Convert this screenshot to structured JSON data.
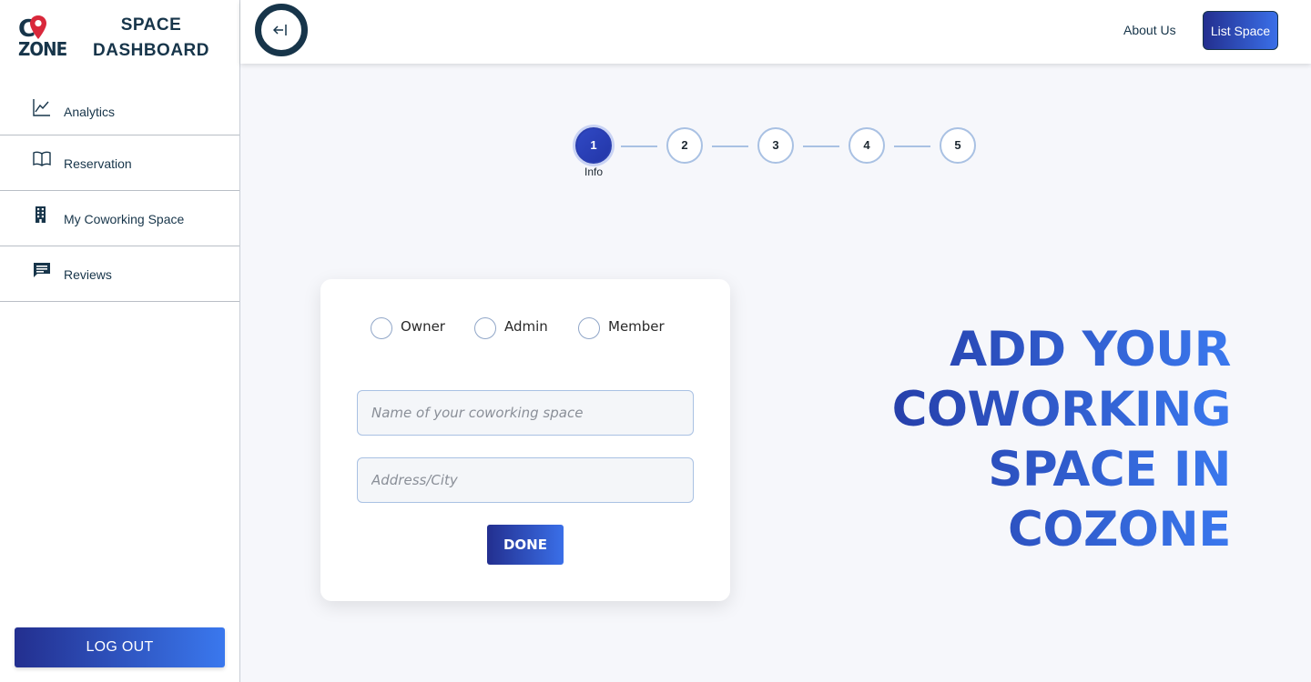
{
  "brand": {
    "logo_top": "C",
    "logo_bottom": "ZONE",
    "title_line1": "SPACE",
    "title_line2": "DASHBOARD"
  },
  "sidebar": {
    "items": [
      {
        "label": "Analytics",
        "icon": "chart-line-icon"
      },
      {
        "label": "Reservation",
        "icon": "book-open-icon"
      },
      {
        "label": "My Coworking Space",
        "icon": "building-icon"
      },
      {
        "label": "Reviews",
        "icon": "message-icon"
      }
    ],
    "logout_label": "LOG OUT"
  },
  "header": {
    "collapse_icon": "arrow-left-bar-icon",
    "about_label": "About Us",
    "list_space_label": "List Space"
  },
  "stepper": {
    "steps": [
      "1",
      "2",
      "3",
      "4",
      "5"
    ],
    "active_step": 1,
    "active_caption": "Info"
  },
  "form": {
    "roles": [
      "Owner",
      "Admin",
      "Member"
    ],
    "name_placeholder": "Name of your coworking space",
    "name_value": "",
    "address_placeholder": "Address/City",
    "address_value": "",
    "submit_label": "DONE"
  },
  "headline": {
    "lines": [
      "ADD YOUR",
      "COWORKING",
      "SPACE IN",
      "COZONE"
    ]
  },
  "colors": {
    "navy": "#17354a",
    "gradient_start": "#232f8f",
    "gradient_end": "#3a78ee",
    "pin_red": "#d9283b"
  }
}
